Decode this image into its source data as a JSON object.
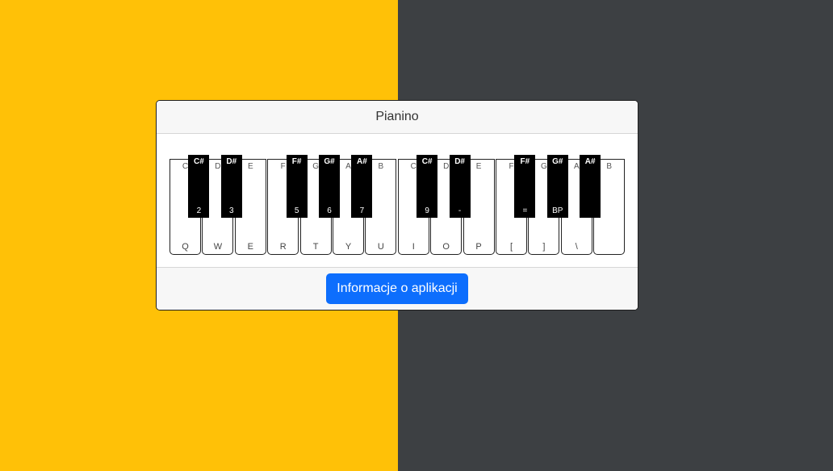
{
  "colors": {
    "left_bg": "#ffc107",
    "right_bg": "#3d4043",
    "button_bg": "#0d6efd"
  },
  "card": {
    "title": "Pianino",
    "info_button_label": "Informacje o aplikacji"
  },
  "keyboard": {
    "white_keys": [
      {
        "note": "C",
        "hotkey": "Q"
      },
      {
        "note": "D",
        "hotkey": "W"
      },
      {
        "note": "E",
        "hotkey": "E"
      },
      {
        "note": "F",
        "hotkey": "R"
      },
      {
        "note": "G",
        "hotkey": "T"
      },
      {
        "note": "A",
        "hotkey": "Y"
      },
      {
        "note": "B",
        "hotkey": "U"
      },
      {
        "note": "C",
        "hotkey": "I"
      },
      {
        "note": "D",
        "hotkey": "O"
      },
      {
        "note": "E",
        "hotkey": "P"
      },
      {
        "note": "F",
        "hotkey": "["
      },
      {
        "note": "G",
        "hotkey": "]"
      },
      {
        "note": "A",
        "hotkey": "\\"
      },
      {
        "note": "B",
        "hotkey": ""
      }
    ],
    "black_keys": [
      {
        "note": "C#",
        "hotkey": "2",
        "after_white": 0
      },
      {
        "note": "D#",
        "hotkey": "3",
        "after_white": 1
      },
      {
        "note": "F#",
        "hotkey": "5",
        "after_white": 3
      },
      {
        "note": "G#",
        "hotkey": "6",
        "after_white": 4
      },
      {
        "note": "A#",
        "hotkey": "7",
        "after_white": 5
      },
      {
        "note": "C#",
        "hotkey": "9",
        "after_white": 7
      },
      {
        "note": "D#",
        "hotkey": "-",
        "after_white": 8
      },
      {
        "note": "F#",
        "hotkey": "=",
        "after_white": 10
      },
      {
        "note": "G#",
        "hotkey": "BP",
        "after_white": 11
      },
      {
        "note": "A#",
        "hotkey": "",
        "after_white": 12
      }
    ]
  }
}
